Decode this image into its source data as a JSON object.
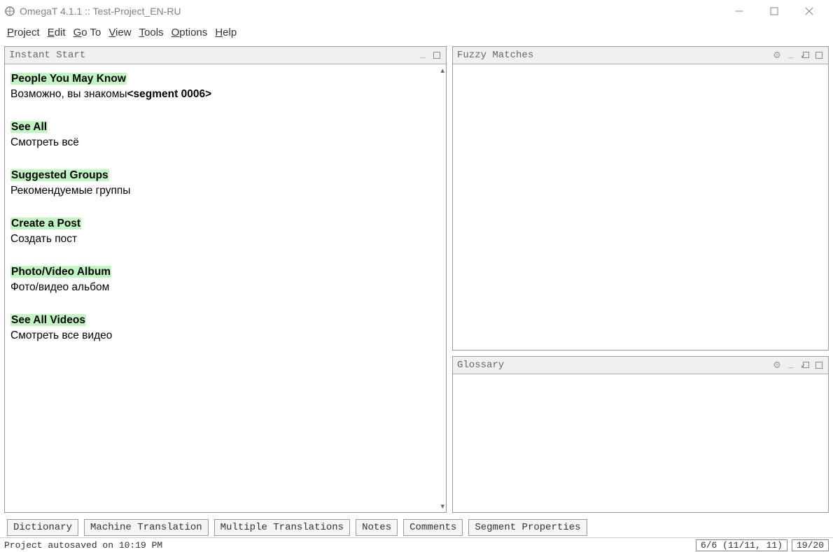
{
  "window": {
    "title": "OmegaT 4.1.1 :: Test-Project_EN-RU"
  },
  "menubar": {
    "project": "Project",
    "edit": "Edit",
    "goto": "Go To",
    "view": "View",
    "tools": "Tools",
    "options": "Options",
    "help": "Help"
  },
  "panels": {
    "editor_title": "Instant Start",
    "fuzzy_title": "Fuzzy Matches",
    "glossary_title": "Glossary"
  },
  "segments": [
    {
      "source": "People You May Know",
      "target": "Возможно, вы знакомы",
      "marker": "<segment 0006>"
    },
    {
      "source": "See All",
      "target": "Смотреть всё",
      "marker": ""
    },
    {
      "source": "Suggested Groups",
      "target": "Рекомендуемые группы",
      "marker": ""
    },
    {
      "source": "Create a Post",
      "target": "Создать пост",
      "marker": ""
    },
    {
      "source": "Photo/Video Album",
      "target": "Фото/видео альбом",
      "marker": ""
    },
    {
      "source": "See All Videos",
      "target": "Смотреть все видео",
      "marker": ""
    }
  ],
  "bottom_tabs": {
    "dictionary": "Dictionary",
    "machine_translation": "Machine Translation",
    "multiple_translations": "Multiple Translations",
    "notes": "Notes",
    "comments": "Comments",
    "segment_properties": "Segment Properties"
  },
  "statusbar": {
    "message": "Project autosaved on 10:19 PM",
    "segment_counter": "6/6 (11/11, 11)",
    "file_counter": "19/20"
  }
}
